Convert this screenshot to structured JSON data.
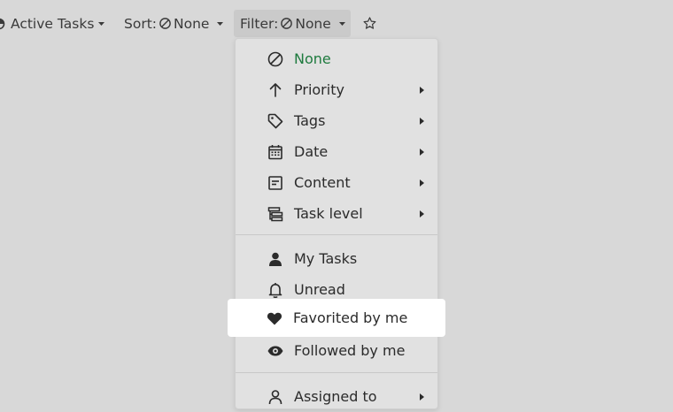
{
  "toolbar": {
    "view_label": "Active Tasks",
    "sort_prefix": "Sort:",
    "sort_value": "None",
    "filter_prefix": "Filter:",
    "filter_value": "None"
  },
  "filter_menu": {
    "items": [
      {
        "label": "None",
        "icon": "none-circle-icon",
        "selected": true,
        "submenu": false
      },
      {
        "label": "Priority",
        "icon": "arrow-up-icon",
        "submenu": true
      },
      {
        "label": "Tags",
        "icon": "tag-icon",
        "submenu": true
      },
      {
        "label": "Date",
        "icon": "calendar-icon",
        "submenu": true
      },
      {
        "label": "Content",
        "icon": "document-icon",
        "submenu": true
      },
      {
        "label": "Task level",
        "icon": "hierarchy-icon",
        "submenu": true
      }
    ],
    "people_items": [
      {
        "label": "My Tasks",
        "icon": "person-icon"
      },
      {
        "label": "Unread",
        "icon": "bell-icon"
      },
      {
        "label": "Favorited by me",
        "icon": "heart-icon",
        "highlighted": true
      },
      {
        "label": "Followed by me",
        "icon": "eye-icon"
      }
    ],
    "more_items": [
      {
        "label": "Assigned to",
        "icon": "person-outline-icon",
        "submenu": true
      }
    ]
  },
  "colors": {
    "background": "#d8d8d8",
    "menu_background": "#e1e1e1",
    "selected_text": "#1e7a3e",
    "highlight": "#ffffff"
  }
}
